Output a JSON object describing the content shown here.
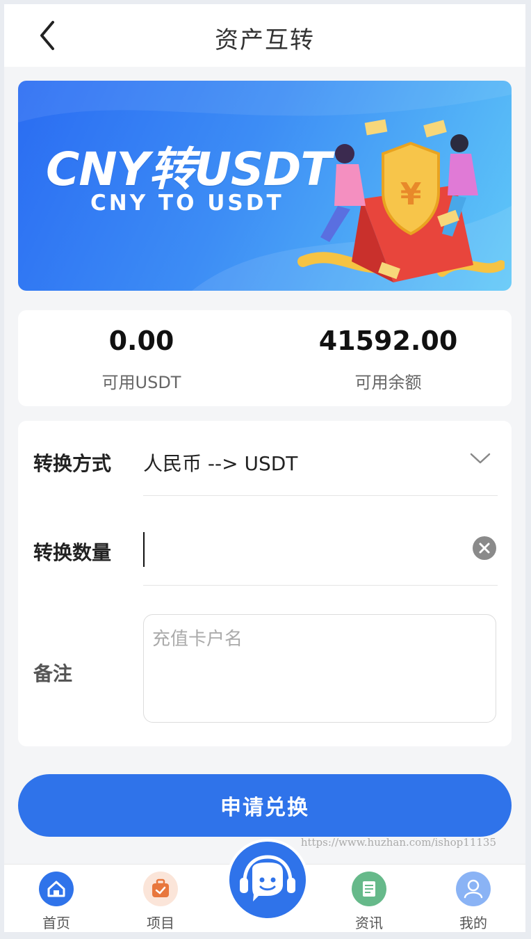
{
  "header": {
    "title": "资产互转"
  },
  "banner": {
    "title": "CNY转USDT",
    "subtitle": "CNY TO USDT"
  },
  "balances": [
    {
      "value": "0.00",
      "label": "可用USDT"
    },
    {
      "value": "41592.00",
      "label": "可用余额"
    }
  ],
  "form": {
    "method_label": "转换方式",
    "method_value": "人民币 --> USDT",
    "quantity_label": "转换数量",
    "quantity_value": "",
    "remark_label": "备注",
    "remark_placeholder": "充值卡户名"
  },
  "submit_label": "申请兑换",
  "watermark": "https://www.huzhan.com/ishop11135",
  "tabbar": {
    "items": [
      {
        "label": "首页",
        "icon": "home-icon"
      },
      {
        "label": "项目",
        "icon": "project-icon"
      },
      {
        "label": "",
        "icon": "customer-service-icon"
      },
      {
        "label": "资讯",
        "icon": "news-icon"
      },
      {
        "label": "我的",
        "icon": "user-icon"
      }
    ]
  },
  "colors": {
    "primary": "#2f73ea",
    "background": "#f4f5f7"
  }
}
